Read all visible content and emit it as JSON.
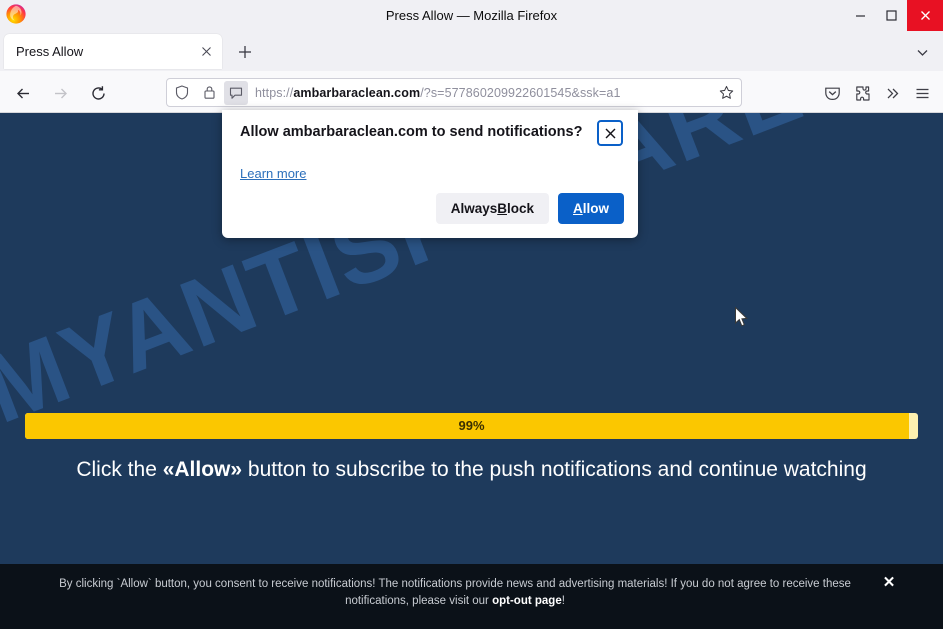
{
  "window": {
    "title": "Press Allow — Mozilla Firefox",
    "minimize_label": "Minimize",
    "maximize_label": "Maximize",
    "close_label": "Close"
  },
  "tabbar": {
    "tab_title": "Press Allow",
    "tab_close_label": "Close tab",
    "new_tab_label": "New tab",
    "list_all_tabs_label": "List all tabs"
  },
  "toolbar": {
    "back_label": "Back",
    "forward_label": "Forward",
    "reload_label": "Reload",
    "shield_label": "shield-icon",
    "lock_label": "lock-icon",
    "permission_label": "notification-permission-icon",
    "url_scheme": "https://",
    "url_domain": "ambarbaraclean.com",
    "url_path": "/?s=577860209922601545&ssk=a1",
    "url_full": "https://ambarbaraclean.com/?s=577860209922601545&ssk=a1",
    "bookmark_label": "Bookmark this page",
    "pocket_label": "Save to Pocket",
    "extensions_label": "Extensions",
    "overflow_label": "More tools",
    "menu_label": "Open application menu"
  },
  "doorhanger": {
    "title": "Allow ambarbaraclean.com to send notifications?",
    "learn_more": "Learn more",
    "close_label": "Close",
    "block_button": {
      "prefix": "Always ",
      "accesskey": "B",
      "suffix": "lock"
    },
    "allow_button": {
      "accesskey": "A",
      "suffix": "llow"
    }
  },
  "page": {
    "watermark": "MYANTISPYWARE.COM",
    "progress_percent": 99,
    "progress_label": "99%",
    "cta_prefix": "Click the ",
    "cta_emphasis": "«Allow»",
    "cta_suffix": " button to subscribe to the push notifications and continue watching",
    "background_color": "#1e3a5c",
    "progress_fill_color": "#fbc700",
    "progress_track_color": "#fdf0b0"
  },
  "consent_banner": {
    "text_part1": "By clicking `Allow` button, you consent to receive notifications! The notifications provide news and advertising materials! If you do not agree to receive these notifications, please visit our ",
    "link_text": "opt-out page",
    "text_part2": "!",
    "close_label": "✕",
    "background_color": "#0b1118"
  }
}
